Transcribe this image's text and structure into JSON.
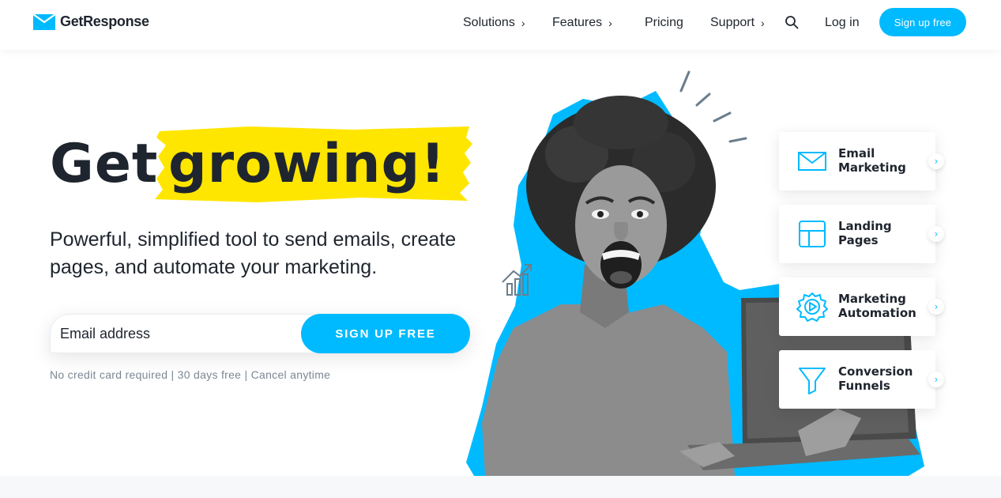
{
  "brand": {
    "name": "GetResponse",
    "accent": "#00baff",
    "highlight": "#ffe600",
    "text": "#1f252e"
  },
  "nav": {
    "items": [
      {
        "label": "Solutions",
        "has_submenu": true
      },
      {
        "label": "Features",
        "has_submenu": true
      },
      {
        "label": "Pricing",
        "has_submenu": false
      },
      {
        "label": "Support",
        "has_submenu": true
      }
    ],
    "search_icon": "search-icon",
    "login_label": "Log in",
    "signup_label": "Sign up free"
  },
  "hero": {
    "headline_part1": "Get",
    "headline_part2": "growing!",
    "subtitle": "Powerful, simplified tool to send emails, create pages, and automate your marketing.",
    "email_placeholder": "Email address",
    "cta_label": "SIGN UP FREE",
    "fineprint": "No credit card required | 30 days free | Cancel anytime"
  },
  "features": [
    {
      "label": "Email Marketing",
      "icon": "envelope-icon"
    },
    {
      "label": "Landing Pages",
      "icon": "layout-icon"
    },
    {
      "label": "Marketing Automation",
      "icon": "gear-play-icon"
    },
    {
      "label": "Conversion Funnels",
      "icon": "funnel-icon"
    }
  ]
}
